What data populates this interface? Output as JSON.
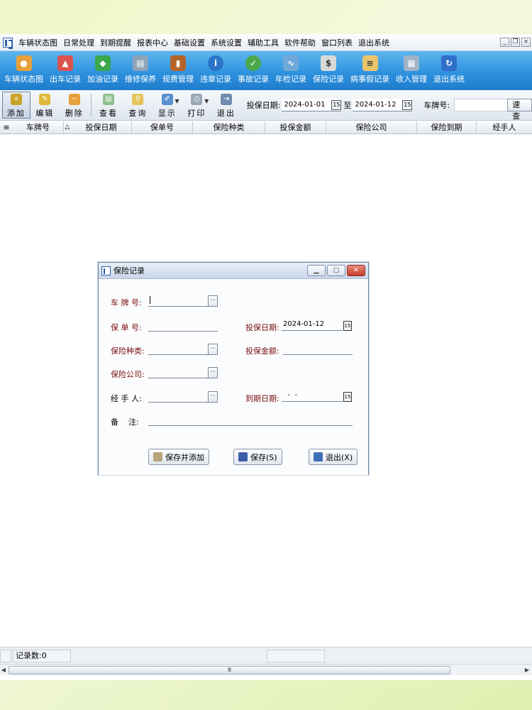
{
  "menu": {
    "items": [
      "车辆状态图",
      "日常处理",
      "到期提醒",
      "报表中心",
      "基础设置",
      "系统设置",
      "辅助工具",
      "软件帮助",
      "窗口列表",
      "退出系统"
    ]
  },
  "toolbar_main": {
    "items": [
      {
        "label": "车辆状态图",
        "icon": "car-status-icon",
        "color": "#e8a13a"
      },
      {
        "label": "出车记录",
        "icon": "dispatch-icon",
        "color": "#d9534f"
      },
      {
        "label": "加油记录",
        "icon": "fuel-icon",
        "color": "#3aa84b"
      },
      {
        "label": "维修保养",
        "icon": "maintenance-icon",
        "color": "#8fa3b8"
      },
      {
        "label": "规费管理",
        "icon": "fee-book-icon",
        "color": "#b5652b"
      },
      {
        "label": "违章记录",
        "icon": "violation-info-icon",
        "color": "#2b74c7"
      },
      {
        "label": "事故记录",
        "icon": "accident-check-icon",
        "color": "#4aa84a"
      },
      {
        "label": "年检记录",
        "icon": "annual-inspection-icon",
        "color": "#6fa9d9"
      },
      {
        "label": "保险记录",
        "icon": "insurance-doc-icon",
        "color": "#d8d8d8"
      },
      {
        "label": "病事假记录",
        "icon": "leave-doc-icon",
        "color": "#e9c46a"
      },
      {
        "label": "收入管理",
        "icon": "income-calculator-icon",
        "color": "#9fb3c8"
      },
      {
        "label": "退出系统",
        "icon": "exit-icon",
        "color": "#2f6fc9"
      }
    ]
  },
  "toolbar_small": {
    "add": "添加",
    "edit": "编辑",
    "delete": "删除",
    "view": "查看",
    "query": "查询",
    "display": "显示",
    "print": "打印",
    "exit": "退出",
    "date_label": "投保日期:",
    "date_from": "2024-01-01",
    "to_label": "至",
    "date_to": "2024-01-12",
    "plate_label": "车牌号:",
    "plate_value": "",
    "quick_search": "速查"
  },
  "grid": {
    "menu_icon": "≡",
    "columns": [
      "车牌号",
      "投保日期",
      "保单号",
      "保险种类",
      "投保金额",
      "保险公司",
      "保险到期",
      "经手人"
    ],
    "sort_indicator": "△"
  },
  "status": {
    "record_count": "记录数:0",
    "scroll_grip": "Ⅲ"
  },
  "dialog": {
    "title": "保险记录",
    "fields": {
      "plate_label": "车 牌 号:",
      "plate_value": "",
      "policy_label": "保 单 号:",
      "policy_value": "",
      "insure_date_label": "投保日期:",
      "insure_date_value": "2024-01-12",
      "type_label": "保险种类:",
      "type_value": "",
      "amount_label": "投保金额:",
      "amount_value": "",
      "company_label": "保险公司:",
      "company_value": "",
      "handler_label": "经 手 人:",
      "handler_value": "",
      "expire_label": "到期日期:",
      "expire_value": "  -  -",
      "note_label": "备    注:",
      "note_value": ""
    },
    "buttons": {
      "save_add": "保存并添加",
      "save": "保存(S)",
      "exit": "退出(X)"
    }
  }
}
